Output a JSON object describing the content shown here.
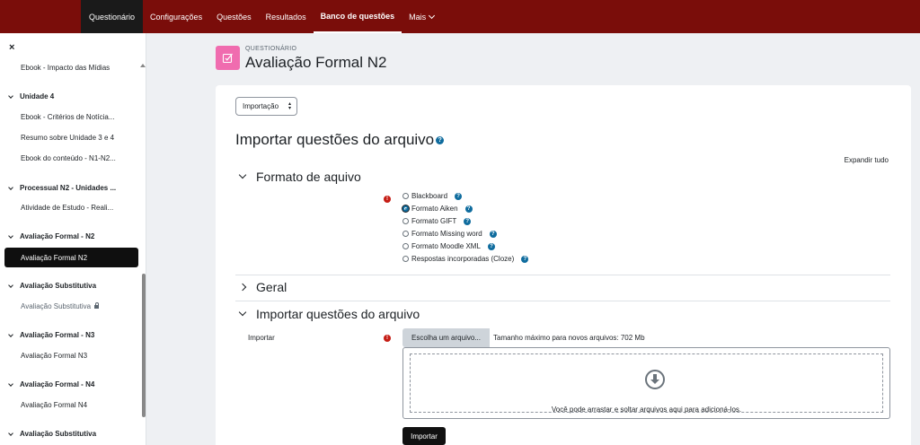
{
  "nav": {
    "tabs": [
      {
        "label": "Questionário"
      },
      {
        "label": "Configurações"
      },
      {
        "label": "Questões"
      },
      {
        "label": "Resultados"
      },
      {
        "label": "Banco de questões"
      },
      {
        "label": "Mais"
      }
    ],
    "active_tab": "Banco de questões"
  },
  "sidebar": {
    "close_glyph": "×",
    "items": [
      {
        "label": "Ebook - Impacto das Mídias"
      },
      {
        "label": "Unidade 4"
      },
      {
        "label": "Ebook - Critérios de Notícia..."
      },
      {
        "label": "Resumo sobre Unidade 3 e 4"
      },
      {
        "label": "Ebook do conteúdo - N1-N2..."
      },
      {
        "label": "Processual N2 - Unidades ..."
      },
      {
        "label": "Atividade de Estudo - Reali..."
      },
      {
        "label": "Avaliação Formal - N2"
      },
      {
        "label": "Avaliação Formal N2"
      },
      {
        "label": "Avaliação Substitutiva"
      },
      {
        "label": "Avaliação Substitutiva"
      },
      {
        "label": "Avaliação Formal - N3"
      },
      {
        "label": "Avaliação Formal N3"
      },
      {
        "label": "Avaliação Formal - N4"
      },
      {
        "label": "Avaliação Formal N4"
      },
      {
        "label": "Avaliação Substitutiva"
      }
    ]
  },
  "header": {
    "kicker": "QUESTIONÁRIO",
    "title": "Avaliação Formal N2"
  },
  "main": {
    "select_value": "Importação",
    "heading": "Importar questões do arquivo",
    "help_glyph": "?",
    "expand_all": "Expandir tudo",
    "sections": {
      "format": "Formato de aquivo",
      "general": "Geral",
      "import": "Importar questões do arquivo"
    },
    "formats": [
      {
        "label": "Blackboard",
        "checked": false
      },
      {
        "label": "Formato Aiken",
        "checked": true
      },
      {
        "label": "Formato GIFT",
        "checked": false
      },
      {
        "label": "Formato Missing word",
        "checked": false
      },
      {
        "label": "Formato Moodle XML",
        "checked": false
      },
      {
        "label": "Respostas incorporadas (Cloze)",
        "checked": false
      }
    ],
    "required_glyph": "!",
    "import_label": "Importar",
    "choose_file": "Escolha um arquivo...",
    "max_size": "Tamanho máximo para novos arquivos: 702 Mb",
    "dropzone_text": "Você pode arrastar e soltar arquivos aqui para adicioná-los.",
    "submit": "Importar"
  },
  "colors": {
    "topbar": "#7a0d0a",
    "page_icon": "#f06caf",
    "help_icon": "#0f6c9e",
    "required_icon": "#c51c14"
  }
}
